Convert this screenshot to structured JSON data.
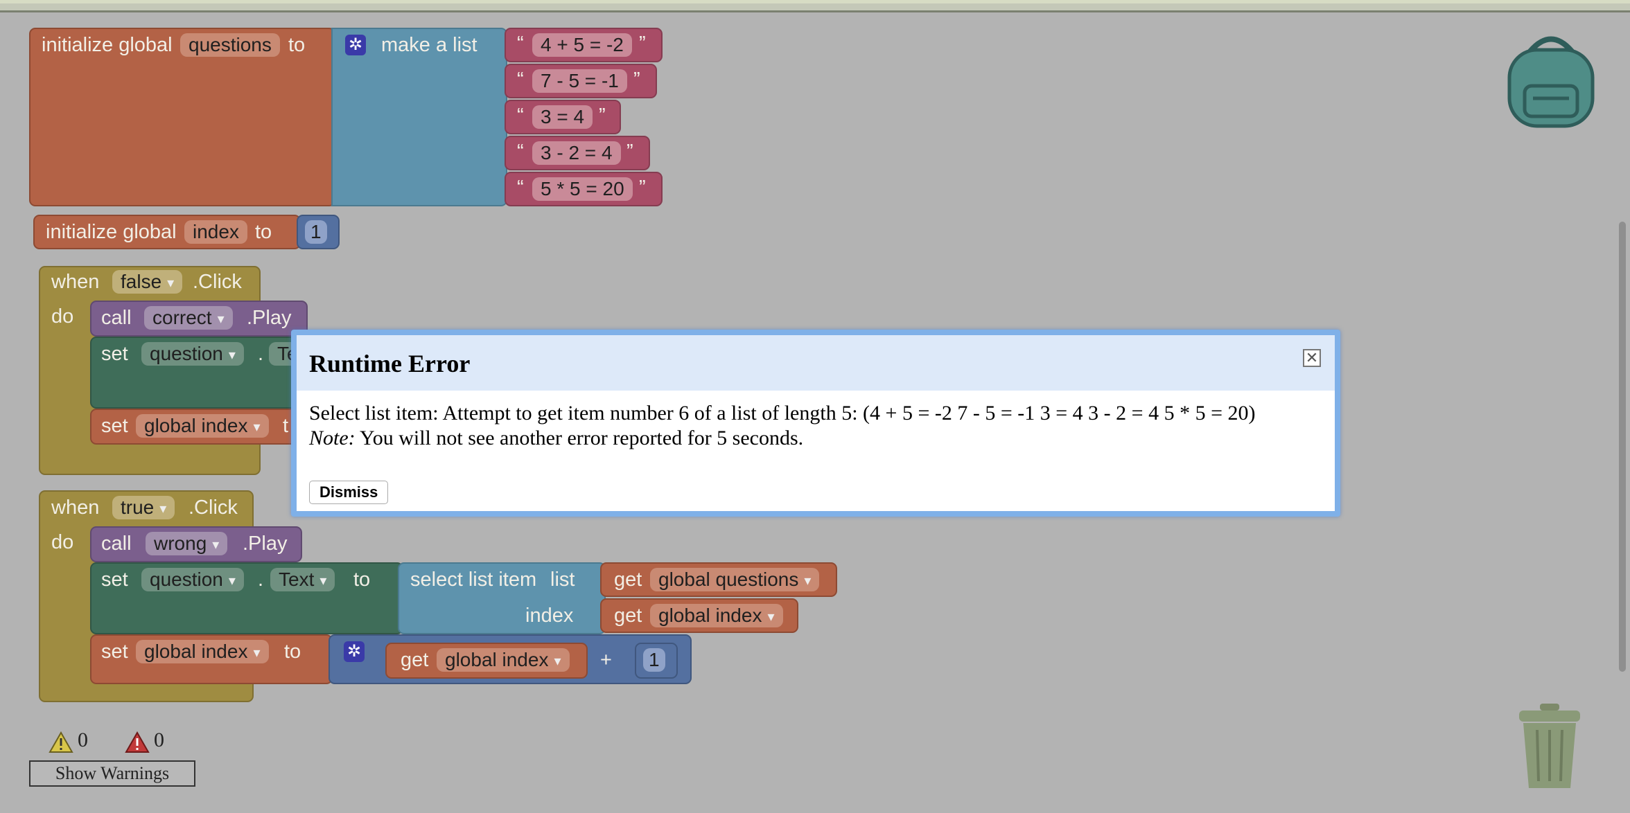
{
  "blocks": {
    "init_questions": {
      "keyword": "initialize global",
      "var": "questions",
      "to": "to",
      "make_list": "make a list",
      "items": [
        "4 + 5 = -2",
        "7 - 5 = -1",
        "3 = 4",
        "3 - 2 = 4",
        "5 * 5 = 20"
      ]
    },
    "init_index": {
      "keyword": "initialize global",
      "var": "index",
      "to": "to",
      "value": "1"
    },
    "when_false": {
      "when": "when",
      "component": "false",
      "event": ".Click",
      "do": "do",
      "call": "call",
      "call_component": "correct",
      "method": ".Play",
      "set1": "set",
      "set1_component": "question",
      "dot": ".",
      "set1_prop": "Te",
      "set2": "set",
      "set2_var": "global index",
      "set2_to": "t"
    },
    "when_true": {
      "when": "when",
      "component": "true",
      "event": ".Click",
      "do": "do",
      "call": "call",
      "call_component": "wrong",
      "method": ".Play",
      "set1": "set",
      "set1_component": "question",
      "dot": ".",
      "set1_prop": "Text",
      "to": "to",
      "select_list_item": "select list item",
      "list": "list",
      "index": "index",
      "get": "get",
      "get_questions": "global questions",
      "get_index": "global index",
      "set2": "set",
      "set2_var": "global index",
      "set2_to": "to",
      "plus": "+",
      "one": "1"
    }
  },
  "dialog": {
    "title": "Runtime Error",
    "message": "Select list item: Attempt to get item number 6 of a list of length 5: (4 + 5 = -2 7 - 5 = -1 3 = 4 3 - 2 = 4 5 * 5 = 20)",
    "note_label": "Note:",
    "note_text": " You will not see another error reported for 5 seconds.",
    "dismiss": "Dismiss"
  },
  "warnings": {
    "warning_count": "0",
    "error_count": "0",
    "button": "Show Warnings"
  },
  "icons": {
    "backpack": "backpack-icon",
    "trash": "trash-icon",
    "warning": "warning-icon",
    "error": "error-icon",
    "mutator": "gear-icon"
  }
}
